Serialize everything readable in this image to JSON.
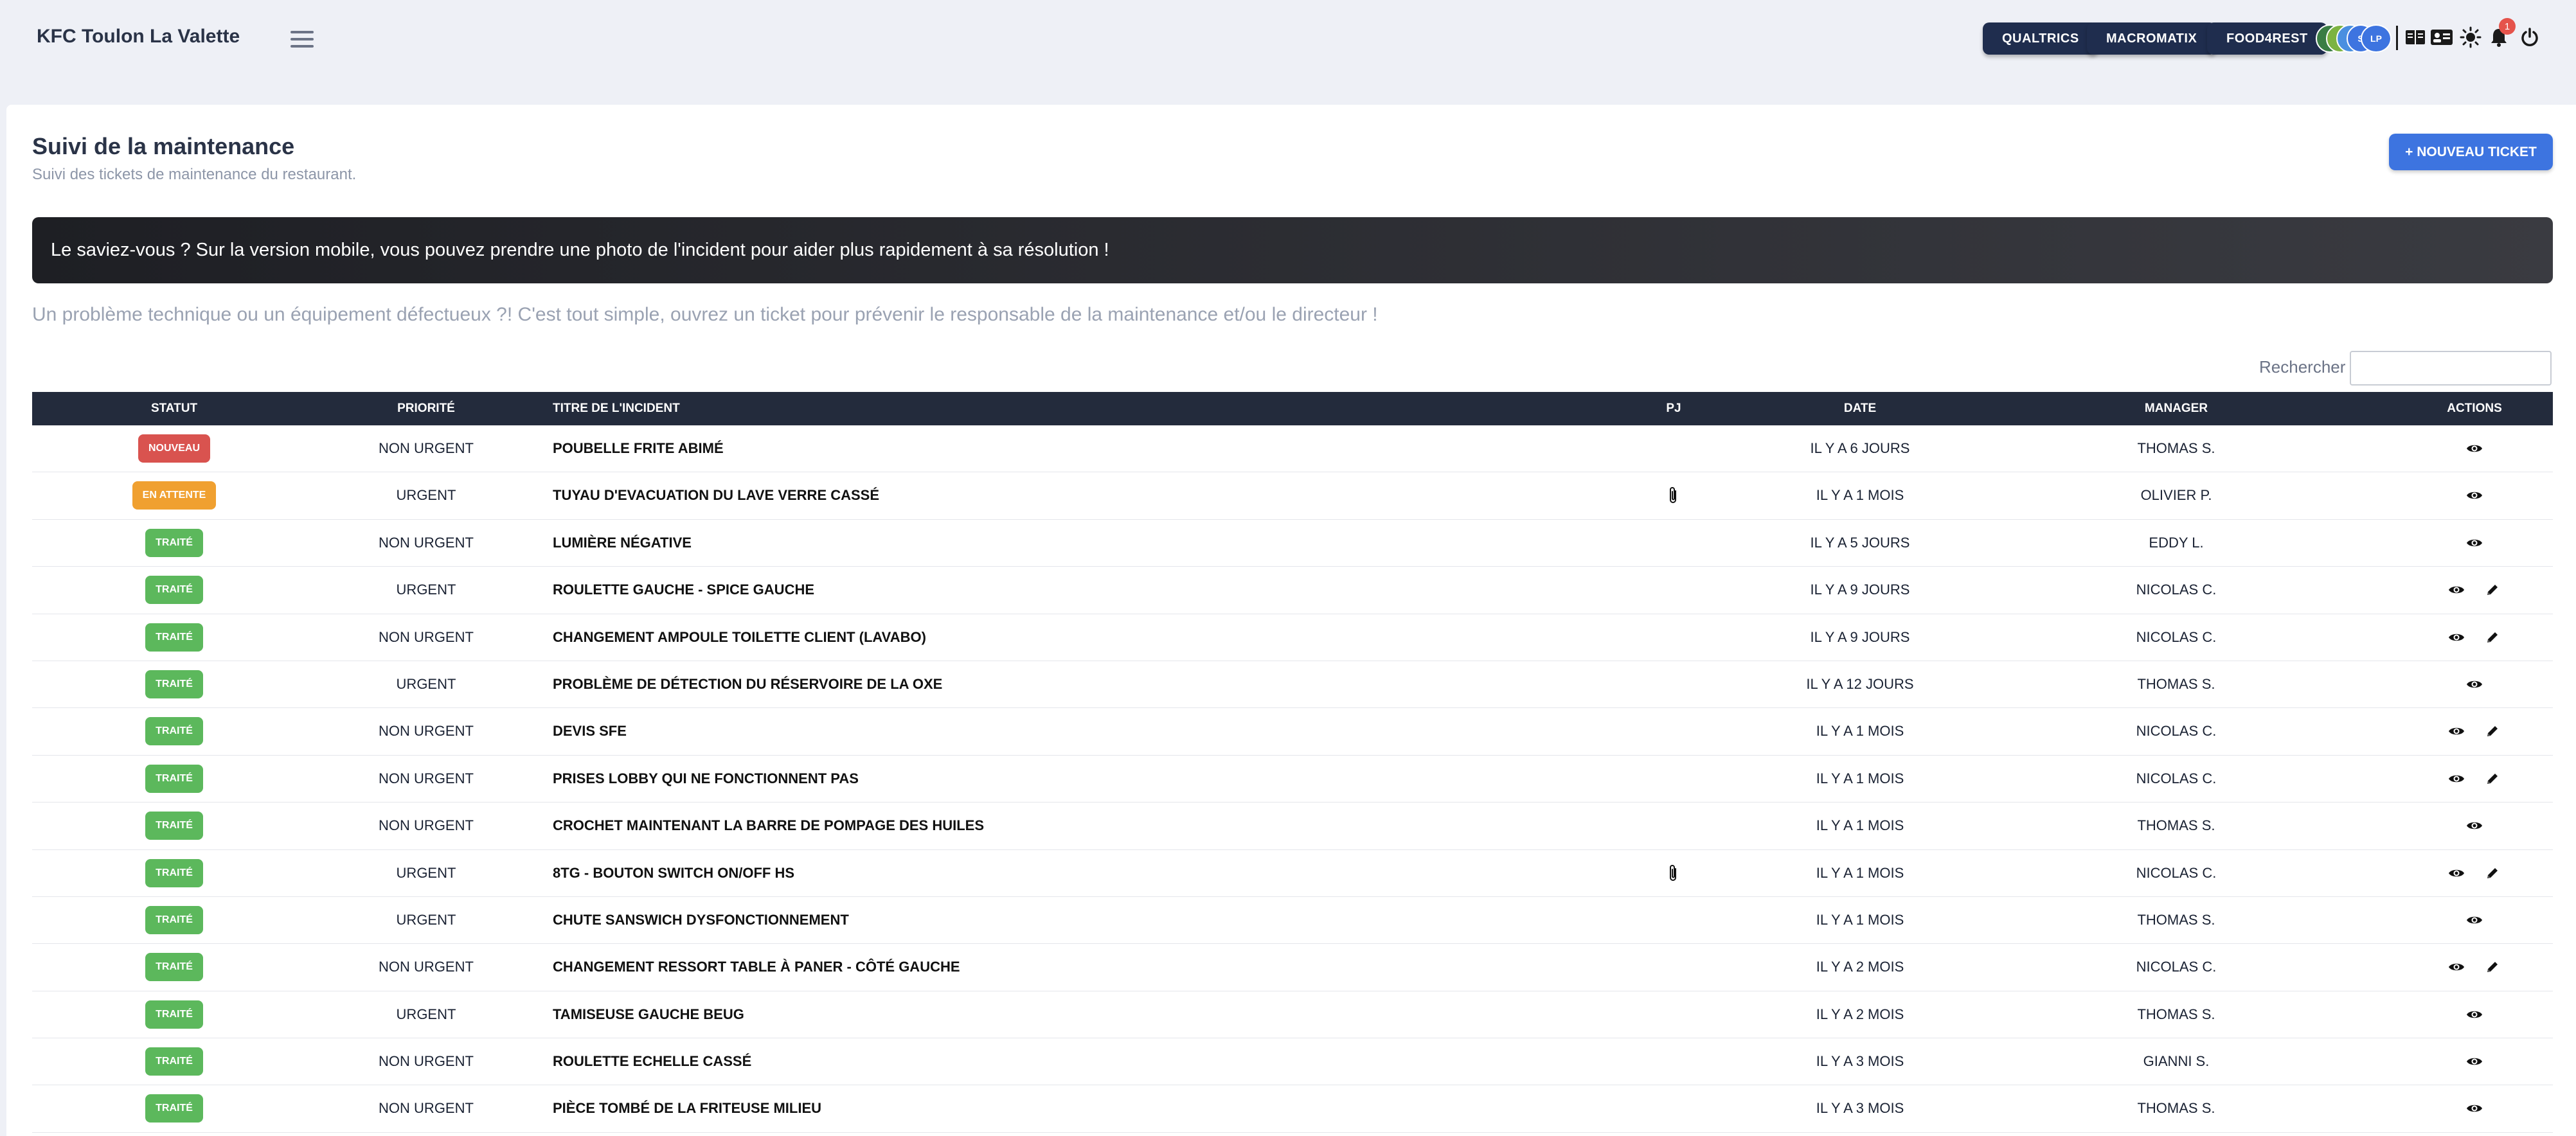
{
  "header": {
    "app_title": "KFC Toulon La Valette",
    "buttons": [
      "QUALTRICS",
      "MACROMATIX",
      "FOOD4REST"
    ],
    "avatars": [
      {
        "initials": "N",
        "color": "#3a7d44"
      },
      {
        "initials": "S",
        "color": "#7cb342"
      },
      {
        "initials": "C",
        "color": "#4a8fe0"
      },
      {
        "initials": "S",
        "color": "#3d74e0"
      },
      {
        "initials": "LP",
        "color": "#3d74e0"
      }
    ],
    "notification_count": "1",
    "icons": [
      "menu-icon",
      "book-icon",
      "id-card-icon",
      "sun-icon",
      "bell-icon",
      "power-icon"
    ]
  },
  "page": {
    "title": "Suivi de la maintenance",
    "subtitle": "Suivi des tickets de maintenance du restaurant.",
    "new_ticket_label": "+ NOUVEAU TICKET",
    "tip": "Le saviez-vous ? Sur la version mobile, vous pouvez prendre une photo de l'incident pour aider plus rapidement à sa résolution !",
    "info": "Un problème technique ou un équipement défectueux ?! C'est tout simple, ouvrez un ticket pour prévenir le responsable de la maintenance et/ou le directeur !",
    "search_label": "Rechercher :"
  },
  "colors": {
    "accent": "#3d74e0",
    "dark_button": "#1f2d4e",
    "status_nouveau": "#d9534f",
    "status_attente": "#f0a030",
    "status_traite": "#5cb85c"
  },
  "table": {
    "columns": {
      "status": "STATUT",
      "priority": "PRIORITÉ",
      "title": "TITRE DE L'INCIDENT",
      "pj": "PJ",
      "date": "DATE",
      "manager": "MANAGER",
      "actions": "ACTIONS"
    },
    "rows": [
      {
        "status": "NOUVEAU",
        "kind": "nouveau",
        "priority": "NON URGENT",
        "title": "POUBELLE FRITE ABIMÉ",
        "pj": false,
        "date": "IL Y A 6 JOURS",
        "manager": "THOMAS S.",
        "edit": false
      },
      {
        "status": "EN ATTENTE",
        "kind": "attente",
        "priority": "URGENT",
        "title": "TUYAU D'EVACUATION DU LAVE VERRE CASSÉ",
        "pj": true,
        "date": "IL Y A 1 MOIS",
        "manager": "OLIVIER P.",
        "edit": false
      },
      {
        "status": "TRAITÉ",
        "kind": "traite",
        "priority": "NON URGENT",
        "title": "LUMIÈRE NÉGATIVE",
        "pj": false,
        "date": "IL Y A 5 JOURS",
        "manager": "EDDY L.",
        "edit": false
      },
      {
        "status": "TRAITÉ",
        "kind": "traite",
        "priority": "URGENT",
        "title": "ROULETTE GAUCHE - SPICE GAUCHE",
        "pj": false,
        "date": "IL Y A 9 JOURS",
        "manager": "NICOLAS C.",
        "edit": true
      },
      {
        "status": "TRAITÉ",
        "kind": "traite",
        "priority": "NON URGENT",
        "title": "CHANGEMENT AMPOULE TOILETTE CLIENT (LAVABO)",
        "pj": false,
        "date": "IL Y A 9 JOURS",
        "manager": "NICOLAS C.",
        "edit": true
      },
      {
        "status": "TRAITÉ",
        "kind": "traite",
        "priority": "URGENT",
        "title": "PROBLÈME DE DÉTECTION DU RÉSERVOIRE DE LA OXE",
        "pj": false,
        "date": "IL Y A 12 JOURS",
        "manager": "THOMAS S.",
        "edit": false
      },
      {
        "status": "TRAITÉ",
        "kind": "traite",
        "priority": "NON URGENT",
        "title": "DEVIS SFE",
        "pj": false,
        "date": "IL Y A 1 MOIS",
        "manager": "NICOLAS C.",
        "edit": true
      },
      {
        "status": "TRAITÉ",
        "kind": "traite",
        "priority": "NON URGENT",
        "title": "PRISES LOBBY QUI NE FONCTIONNENT PAS",
        "pj": false,
        "date": "IL Y A 1 MOIS",
        "manager": "NICOLAS C.",
        "edit": true
      },
      {
        "status": "TRAITÉ",
        "kind": "traite",
        "priority": "NON URGENT",
        "title": "CROCHET MAINTENANT LA BARRE DE POMPAGE DES HUILES",
        "pj": false,
        "date": "IL Y A 1 MOIS",
        "manager": "THOMAS S.",
        "edit": false
      },
      {
        "status": "TRAITÉ",
        "kind": "traite",
        "priority": "URGENT",
        "title": "8TG - BOUTON SWITCH ON/OFF HS",
        "pj": true,
        "date": "IL Y A 1 MOIS",
        "manager": "NICOLAS C.",
        "edit": true
      },
      {
        "status": "TRAITÉ",
        "kind": "traite",
        "priority": "URGENT",
        "title": "CHUTE SANSWICH DYSFONCTIONNEMENT",
        "pj": false,
        "date": "IL Y A 1 MOIS",
        "manager": "THOMAS S.",
        "edit": false
      },
      {
        "status": "TRAITÉ",
        "kind": "traite",
        "priority": "NON URGENT",
        "title": "CHANGEMENT RESSORT TABLE À PANER - CÔTÉ GAUCHE",
        "pj": false,
        "date": "IL Y A 2 MOIS",
        "manager": "NICOLAS C.",
        "edit": true
      },
      {
        "status": "TRAITÉ",
        "kind": "traite",
        "priority": "URGENT",
        "title": "TAMISEUSE GAUCHE BEUG",
        "pj": false,
        "date": "IL Y A 2 MOIS",
        "manager": "THOMAS S.",
        "edit": false
      },
      {
        "status": "TRAITÉ",
        "kind": "traite",
        "priority": "NON URGENT",
        "title": "ROULETTE ECHELLE CASSÉ",
        "pj": false,
        "date": "IL Y A 3 MOIS",
        "manager": "GIANNI S.",
        "edit": false
      },
      {
        "status": "TRAITÉ",
        "kind": "traite",
        "priority": "NON URGENT",
        "title": "PIÈCE TOMBÉ DE LA FRITEUSE MILIEU",
        "pj": false,
        "date": "IL Y A 3 MOIS",
        "manager": "THOMAS S.",
        "edit": false
      }
    ]
  }
}
